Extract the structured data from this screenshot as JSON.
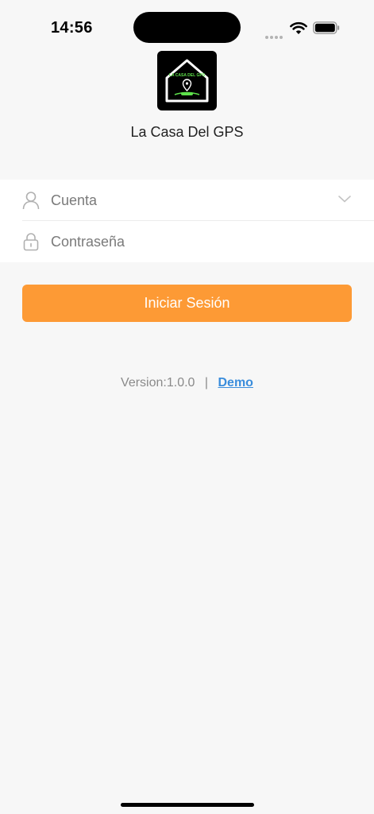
{
  "status_bar": {
    "time": "14:56",
    "icons": [
      "signal-dots-icon",
      "wifi-icon",
      "battery-icon"
    ]
  },
  "app": {
    "logo_icon": "house-gps-logo-icon",
    "logo_text": "LA CASA DEL GPS",
    "name": "La Casa Del GPS"
  },
  "form": {
    "account": {
      "placeholder": "Cuenta",
      "value": "",
      "icon": "user-icon",
      "trailing_icon": "chevron-down-icon"
    },
    "password": {
      "placeholder": "Contraseña",
      "value": "",
      "icon": "lock-icon"
    }
  },
  "login_button": {
    "label": "Iniciar Sesión"
  },
  "footer": {
    "version": "Version:1.0.0",
    "separator": "|",
    "demo_label": "Demo"
  },
  "colors": {
    "accent": "#fd9a35",
    "link": "#3a8ddc",
    "logo_green": "#5de04a",
    "background": "#f7f7f7"
  }
}
